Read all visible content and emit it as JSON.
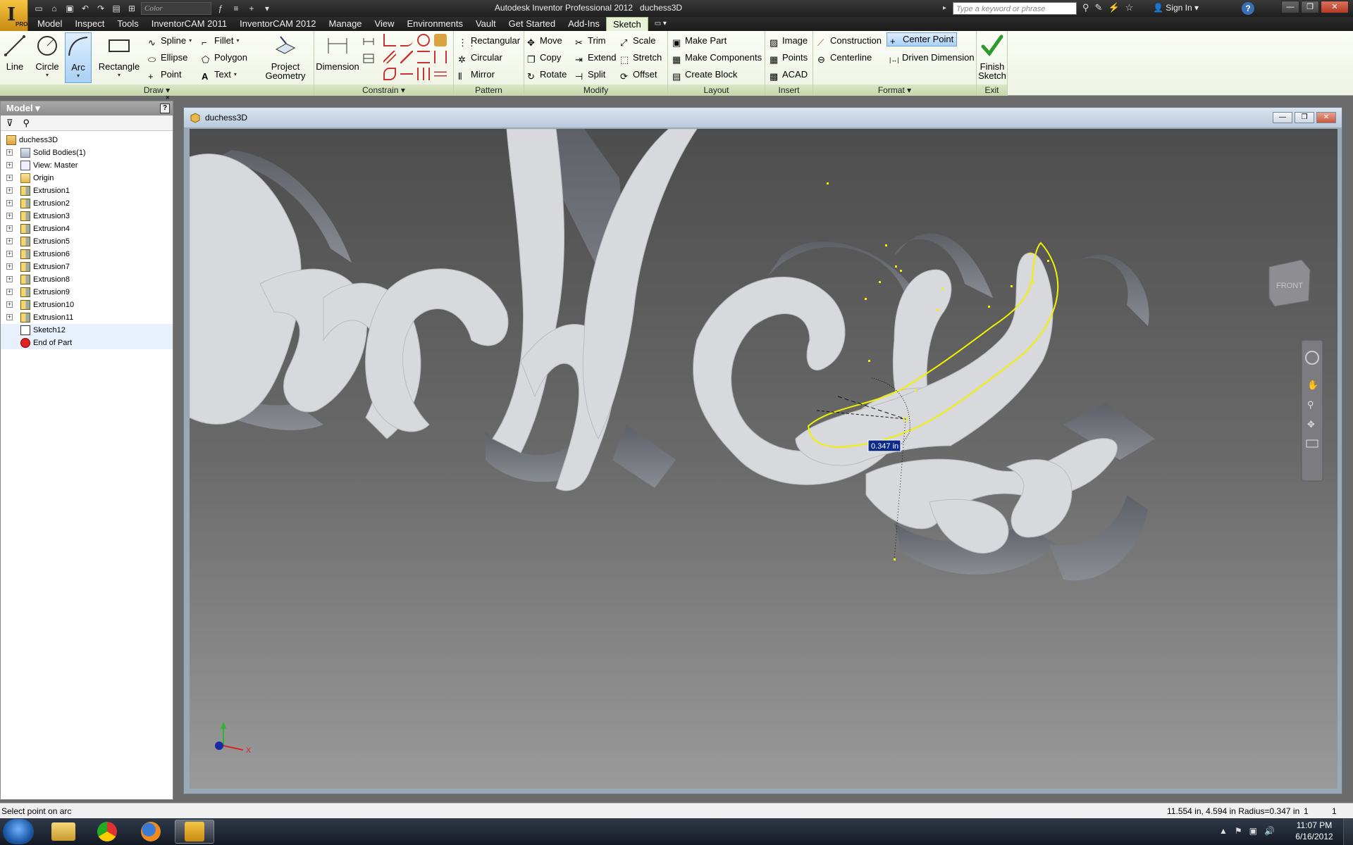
{
  "app": {
    "title": "Autodesk Inventor Professional 2012",
    "document": "duchess3D",
    "pro_badge": "PRO"
  },
  "qat": {
    "color_combo": "Color",
    "search_placeholder": "Type a keyword or phrase",
    "sign_in": "Sign In"
  },
  "tabs": [
    {
      "label": "Model"
    },
    {
      "label": "Inspect"
    },
    {
      "label": "Tools"
    },
    {
      "label": "InventorCAM 2011"
    },
    {
      "label": "InventorCAM 2012"
    },
    {
      "label": "Manage"
    },
    {
      "label": "View"
    },
    {
      "label": "Environments"
    },
    {
      "label": "Vault"
    },
    {
      "label": "Get Started"
    },
    {
      "label": "Add-Ins"
    },
    {
      "label": "Sketch"
    }
  ],
  "ribbon": {
    "draw": {
      "title": "Draw",
      "line": "Line",
      "circle": "Circle",
      "arc": "Arc",
      "rectangle": "Rectangle",
      "spline": "Spline",
      "ellipse": "Ellipse",
      "point": "Point",
      "fillet": "Fillet",
      "polygon": "Polygon",
      "text": "Text",
      "project_geometry_1": "Project",
      "project_geometry_2": "Geometry"
    },
    "constrain": {
      "title": "Constrain",
      "dimension": "Dimension"
    },
    "pattern": {
      "title": "Pattern",
      "rectangular": "Rectangular",
      "circular": "Circular",
      "mirror": "Mirror"
    },
    "modify": {
      "title": "Modify",
      "move": "Move",
      "copy": "Copy",
      "rotate": "Rotate",
      "trim": "Trim",
      "extend": "Extend",
      "split": "Split",
      "scale": "Scale",
      "stretch": "Stretch",
      "offset": "Offset"
    },
    "layout": {
      "title": "Layout",
      "make_part": "Make Part",
      "make_components": "Make Components",
      "create_block": "Create Block"
    },
    "insert": {
      "title": "Insert",
      "image": "Image",
      "points": "Points",
      "acad": "ACAD"
    },
    "format": {
      "title": "Format",
      "construction": "Construction",
      "centerline": "Centerline",
      "center_point": "Center Point",
      "driven_dimension": "Driven Dimension"
    },
    "exit": {
      "title": "Exit",
      "finish_1": "Finish",
      "finish_2": "Sketch"
    }
  },
  "browser": {
    "title": "Model",
    "help": "?",
    "close": "×",
    "tree": [
      {
        "label": "duchess3D",
        "icon": "part-icon",
        "level": 0,
        "exp": false
      },
      {
        "label": "Solid Bodies(1)",
        "icon": "solid-bodies-icon",
        "level": 1,
        "exp": true
      },
      {
        "label": "View: Master",
        "icon": "view-icon",
        "level": 1,
        "exp": true
      },
      {
        "label": "Origin",
        "icon": "folder-icon",
        "level": 1,
        "exp": true
      },
      {
        "label": "Extrusion1",
        "icon": "extrusion-icon",
        "level": 1,
        "exp": true
      },
      {
        "label": "Extrusion2",
        "icon": "extrusion-icon",
        "level": 1,
        "exp": true
      },
      {
        "label": "Extrusion3",
        "icon": "extrusion-icon",
        "level": 1,
        "exp": true
      },
      {
        "label": "Extrusion4",
        "icon": "extrusion-icon",
        "level": 1,
        "exp": true
      },
      {
        "label": "Extrusion5",
        "icon": "extrusion-icon",
        "level": 1,
        "exp": true
      },
      {
        "label": "Extrusion6",
        "icon": "extrusion-icon",
        "level": 1,
        "exp": true
      },
      {
        "label": "Extrusion7",
        "icon": "extrusion-icon",
        "level": 1,
        "exp": true
      },
      {
        "label": "Extrusion8",
        "icon": "extrusion-icon",
        "level": 1,
        "exp": true
      },
      {
        "label": "Extrusion9",
        "icon": "extrusion-icon",
        "level": 1,
        "exp": true
      },
      {
        "label": "Extrusion10",
        "icon": "extrusion-icon",
        "level": 1,
        "exp": true
      },
      {
        "label": "Extrusion11",
        "icon": "extrusion-icon",
        "level": 1,
        "exp": true
      },
      {
        "label": "Sketch12",
        "icon": "sketch-icon",
        "level": 1,
        "exp": false
      },
      {
        "label": "End of Part",
        "icon": "end-of-part-icon",
        "level": 1,
        "exp": false
      }
    ]
  },
  "viewport": {
    "dimension_value": "0.347 in",
    "viewcube_label": "FRONT",
    "axis_x": "X"
  },
  "status": {
    "prompt": "Select point on arc",
    "coords": "11.554 in, 4.594 in  Radius=0.347 in",
    "n1": "1",
    "n2": "1"
  },
  "taskbar": {
    "time": "11:07 PM",
    "date": "6/16/2012"
  },
  "colors": {
    "sketch_active_tab": "#e9f2d9",
    "selection_yellow": "#f2f200",
    "ribbon_bg": "#eef3e4"
  }
}
